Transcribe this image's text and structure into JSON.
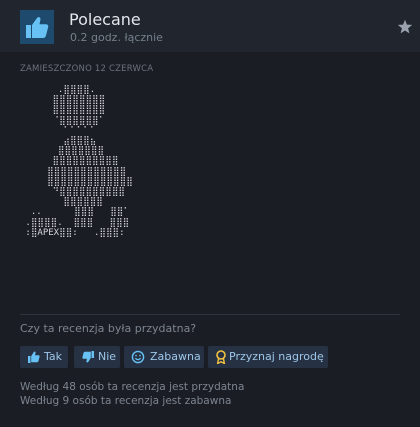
{
  "header": {
    "title": "Polecane",
    "hours": "0.2 godz. łącznie",
    "recommend_icon": "thumbs-up-icon",
    "award_icon": "star-icon"
  },
  "review": {
    "posted": "ZAMIESZCZONO 12 CZERWCA",
    "ascii_art": "       .⣿⣿⣿⣿.\n      ⣿⣿⣿⣿⣿⣿⣿⣿\n      ⣿⣿⣿⣿⣿⣿⣿⣿\n      ⠈⣿⣿⣿⣿⣿⣿⠁\n        ⠁⠁⠁⠁⠁\n        ⣴⣿⣿⣿⣦\n       ⣿⣿⣿⣿⣿⣿⣿\n      ⣿⣿⣿⣿⣿⣿⣿⣿⣿⣿\n     ⣿⣿⣿⣿⣿⣿⣿⣿⣿⣿⣿⣿\n     ⣿⣿⣿⣿⣿⣿⣿⣿⣿⣿⣿⣿⣿\n      ⠙⣿⣿⣿⣿⣿⣿⣿⣿⣿⣿\n        ⣿⣿⣿⣿⣿⣿\n  ..      ⣿⣿⣿   ⣿⣿⠁\n .⣿⣿⣿⣿.  ⣿⣿⣿   ⣿⣿⣿\n :⣿APEX⣿⣿:   .⣿⣿⣿:"
  },
  "helpful": {
    "question": "Czy ta recenzja była przydatna?",
    "yes_label": "Tak",
    "no_label": "Nie",
    "funny_label": "Zabawna",
    "award_label": "Przyznaj nagrodę",
    "icons": {
      "yes": "thumbs-up-icon",
      "no": "thumbs-down-icon",
      "funny": "smiley-icon",
      "award": "award-ribbon-icon"
    }
  },
  "stats": {
    "helpful_line": "Według 48 osób ta recenzja jest przydatna",
    "funny_line": "Według 9 osób ta recenzja jest zabawna"
  },
  "colors": {
    "background": "#1a1d24",
    "header": "#20252e",
    "thumb_box": "#1e4a6d",
    "accent": "#67c1f5",
    "button_bg": "#263243",
    "button_text": "#9ec5e8"
  }
}
